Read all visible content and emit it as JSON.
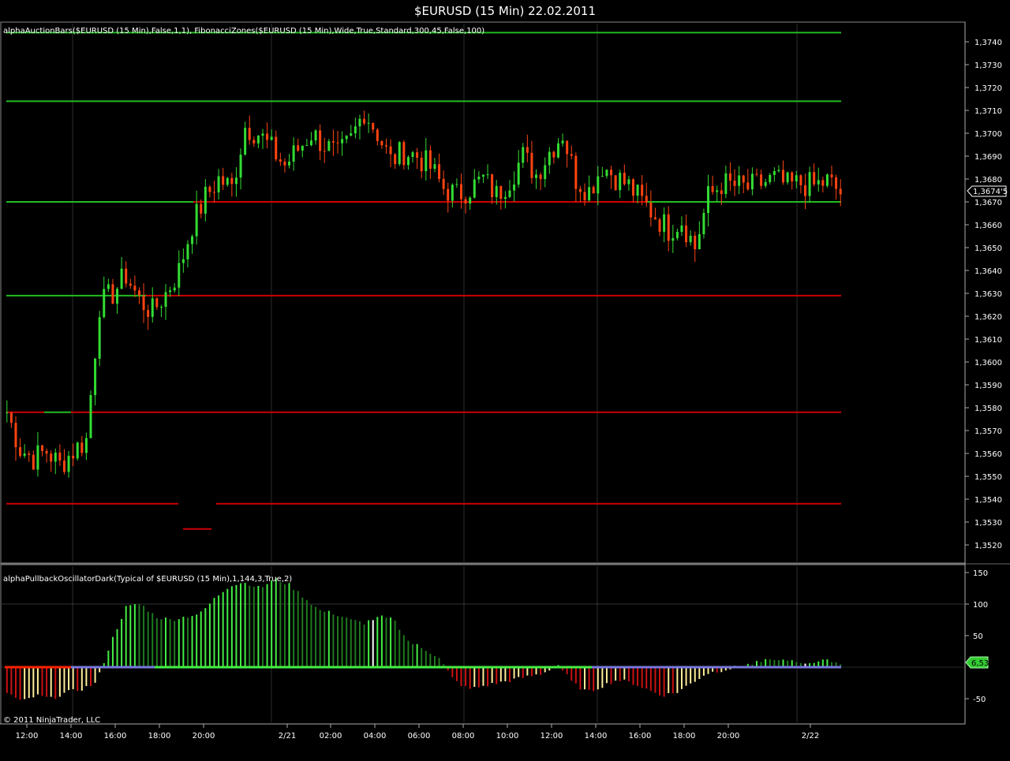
{
  "window": {
    "title": "$EURUSD (15 Min)  22.02.2011"
  },
  "price_panel": {
    "indicator_label": "alphaAuctionBars($EURUSD (15 Min),False,1,1),  FibonacciZones($EURUSD (15 Min),Wide,True,Standard,300,45,False,100)",
    "current_price_label": "1,3674'5"
  },
  "osc_panel": {
    "indicator_label": "alphaPullbackOscillatorDark(Typical of $EURUSD (15 Min),1,144,3,True,2)",
    "current_value_label": "6,53",
    "copyright": "© 2011 NinjaTrader, LLC"
  },
  "colors": {
    "background": "#000000",
    "up_candle": "#33dd33",
    "down_candle": "#ff4411",
    "support_line_green": "#22bb22",
    "resistance_line_red": "#cc0000",
    "osc_green_bright": "#44ee44",
    "osc_green_dark": "#1f7a1f",
    "osc_red": "#cc1111",
    "osc_zero_purple": "#7777dd",
    "grid": "#aaaaaa"
  },
  "chart_data": [
    {
      "type": "candlestick",
      "title": "$EURUSD (15 Min)  22.02.2011",
      "x_tick_labels": [
        "12:00",
        "14:00",
        "16:00",
        "18:00",
        "20:00",
        "2/21",
        "02:00",
        "04:00",
        "06:00",
        "08:00",
        "10:00",
        "12:00",
        "14:00",
        "16:00",
        "18:00",
        "20:00",
        "2/22"
      ],
      "y_tick_labels": [
        "1,3740",
        "1,3730",
        "1,3720",
        "1,3710",
        "1,3700",
        "1,3690",
        "1,3680",
        "1,3670",
        "1,3660",
        "1,3650",
        "1,3640",
        "1,3630",
        "1,3620",
        "1,3610",
        "1,3600",
        "1,3590",
        "1,3580",
        "1,3570",
        "1,3560",
        "1,3550",
        "1,3540",
        "1,3530",
        "1,3520"
      ],
      "ylim": [
        1.3514,
        1.3747
      ],
      "grid": true,
      "price_anchors": [
        1.3578,
        1.3562,
        1.3558,
        1.3561,
        1.3555,
        1.3561,
        1.3566,
        1.3625,
        1.363,
        1.3638,
        1.3627,
        1.3622,
        1.363,
        1.364,
        1.366,
        1.3672,
        1.368,
        1.3676,
        1.3703,
        1.37,
        1.3693,
        1.3686,
        1.3693,
        1.37,
        1.3695,
        1.369,
        1.3697,
        1.371,
        1.37,
        1.3688,
        1.3692,
        1.369,
        1.3685,
        1.3676,
        1.3673,
        1.3676,
        1.368,
        1.3673,
        1.368,
        1.369,
        1.3682,
        1.3692,
        1.37,
        1.368,
        1.3675,
        1.3686,
        1.3681,
        1.3677,
        1.367,
        1.3664,
        1.3658,
        1.3662,
        1.365,
        1.3672,
        1.3678,
        1.3677,
        1.3676,
        1.3678,
        1.368,
        1.3677,
        1.3678,
        1.3677,
        1.3679,
        1.3674
      ],
      "levels": [
        {
          "price": 1.3744,
          "color": "green"
        },
        {
          "price": 1.3714,
          "color": "green"
        },
        {
          "price": 1.367,
          "color": "green/red"
        },
        {
          "price": 1.3629,
          "color": "green/red"
        },
        {
          "price": 1.3578,
          "color": "red"
        },
        {
          "price": 1.3538,
          "color": "red"
        },
        {
          "price": 1.3527,
          "color": "red"
        }
      ],
      "last_price": 1.36745
    },
    {
      "type": "bar",
      "title": "alphaPullbackOscillatorDark(Typical of $EURUSD (15 Min),1,144,3,True,2)",
      "y_tick_labels": [
        "150",
        "100",
        "50",
        "-50"
      ],
      "ylim": [
        -90,
        150
      ],
      "reference_line": 100,
      "value_anchors": [
        -40,
        -55,
        -45,
        -50,
        -40,
        -35,
        -25,
        40,
        95,
        100,
        80,
        75,
        80,
        85,
        110,
        130,
        135,
        125,
        140,
        130,
        110,
        90,
        85,
        75,
        70,
        80,
        75,
        40,
        30,
        15,
        -20,
        -35,
        -30,
        -25,
        -20,
        -15,
        -10,
        5,
        -25,
        -40,
        -30,
        -20,
        -25,
        -35,
        -45,
        -40,
        -25,
        -10,
        -5,
        0,
        5,
        10,
        10,
        8,
        8,
        10,
        6.53
      ],
      "last_value": 6.53
    }
  ]
}
